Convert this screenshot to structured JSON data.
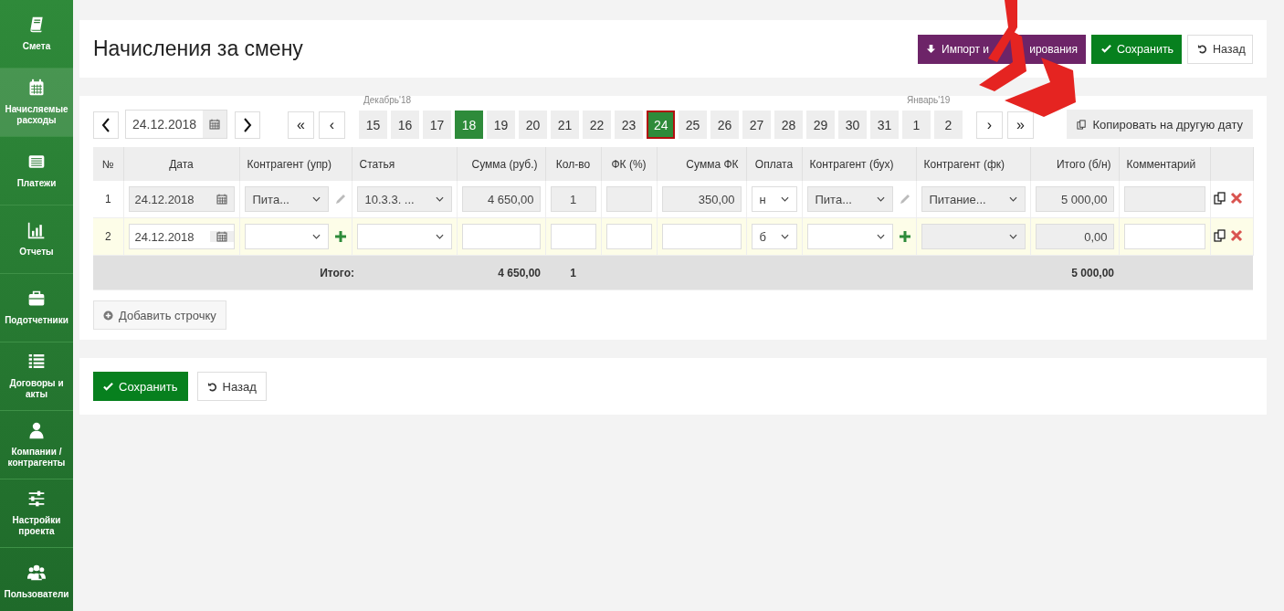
{
  "sidebar": {
    "items": [
      {
        "label": "Смета",
        "selected": false
      },
      {
        "label": "Начисляемые расходы",
        "selected": true
      },
      {
        "label": "Платежи",
        "selected": false
      },
      {
        "label": "Отчеты",
        "selected": false
      },
      {
        "label": "Подотчетники",
        "selected": false
      },
      {
        "label": "Договоры и акты",
        "selected": false
      },
      {
        "label": "Компании / контрагенты",
        "selected": false
      },
      {
        "label": "Настройки проекта",
        "selected": false
      },
      {
        "label": "Пользователи",
        "selected": false
      }
    ]
  },
  "header": {
    "title": "Начисления за смену",
    "buttons": [
      {
        "kind": "import",
        "label_parts": [
          "Импорт и",
          "ирования"
        ]
      },
      {
        "kind": "save",
        "label": "Сохранить"
      },
      {
        "kind": "back",
        "label": "Назад"
      }
    ]
  },
  "calendar": {
    "date": "24.12.2018",
    "first": "«",
    "prev": "‹",
    "next": "›",
    "last": "»",
    "copy_button": "Копировать на другую дату",
    "days": [
      {
        "label": "15",
        "month_label": "Декабрь'18",
        "today": false,
        "selected": false
      },
      {
        "label": "16",
        "today": false,
        "selected": false
      },
      {
        "label": "17",
        "today": false,
        "selected": false
      },
      {
        "label": "18",
        "today": true,
        "selected": false
      },
      {
        "label": "19",
        "today": false,
        "selected": false
      },
      {
        "label": "20",
        "today": false,
        "selected": false
      },
      {
        "label": "21",
        "today": false,
        "selected": false
      },
      {
        "label": "22",
        "today": false,
        "selected": false
      },
      {
        "label": "23",
        "today": false,
        "selected": false
      },
      {
        "label": "24",
        "today": true,
        "selected": true
      },
      {
        "label": "25",
        "today": false,
        "selected": false
      },
      {
        "label": "26",
        "today": false,
        "selected": false
      },
      {
        "label": "27",
        "today": false,
        "selected": false
      },
      {
        "label": "28",
        "today": false,
        "selected": false
      },
      {
        "label": "29",
        "today": false,
        "selected": false
      },
      {
        "label": "30",
        "today": false,
        "selected": false
      },
      {
        "label": "31",
        "today": false,
        "selected": false
      },
      {
        "label": "1",
        "month_label": "Январь'19",
        "today": false,
        "selected": false
      },
      {
        "label": "2",
        "today": false,
        "selected": false
      }
    ]
  },
  "table": {
    "columns": [
      "№",
      "Дата",
      "Контрагент (упр)",
      "Статья",
      "Сумма (руб.)",
      "Кол-во",
      "ФК (%)",
      "Сумма ФК",
      "Оплата",
      "Контрагент (бух)",
      "Контрагент (фк)",
      "Итого (б/н)",
      "Комментарий"
    ],
    "rows": [
      {
        "selected": false,
        "cells": [
          {
            "kind": "number",
            "value": "1"
          },
          {
            "kind": "date",
            "value": "24.12.2018",
            "disabled": true
          },
          {
            "kind": "select",
            "value": "Пита...",
            "disabled": true,
            "editable": true
          },
          {
            "kind": "select",
            "value": "10.3.3. ...",
            "disabled": true
          },
          {
            "kind": "text",
            "value": "4 650,00",
            "disabled": true
          },
          {
            "kind": "text",
            "value": "1",
            "disabled": true
          },
          {
            "kind": "text",
            "disabled": true
          },
          {
            "kind": "text",
            "value": "350,00",
            "disabled": true
          },
          {
            "kind": "select",
            "value": "н",
            "disabled": false
          },
          {
            "kind": "select",
            "value": "Пита...",
            "disabled": true,
            "editable": true
          },
          {
            "kind": "select",
            "value": "Питание...",
            "disabled": true
          },
          {
            "kind": "text",
            "value": "5 000,00",
            "disabled": true
          },
          {
            "kind": "text",
            "disabled": true
          }
        ]
      },
      {
        "selected": true,
        "cells": [
          {
            "kind": "number",
            "value": "2"
          },
          {
            "kind": "date",
            "value": "24.12.2018",
            "disabled": false
          },
          {
            "kind": "select",
            "disabled": false,
            "can_add": true
          },
          {
            "kind": "select",
            "disabled": false
          },
          {
            "kind": "text",
            "disabled": false
          },
          {
            "kind": "text",
            "disabled": false
          },
          {
            "kind": "text",
            "disabled": false
          },
          {
            "kind": "text",
            "disabled": false
          },
          {
            "kind": "select",
            "value": "б",
            "disabled": false
          },
          {
            "kind": "select",
            "disabled": false,
            "can_add": true
          },
          {
            "kind": "select",
            "disabled": true
          },
          {
            "kind": "text",
            "value": "0,00",
            "disabled": true
          },
          {
            "kind": "text",
            "disabled": false
          }
        ]
      }
    ],
    "totals": {
      "label": "Итого:",
      "sum": "4 650,00",
      "quantity": "1",
      "total": "5 000,00"
    }
  },
  "add_row_button": "Добавить строчку",
  "footer": {
    "save": "Сохранить",
    "back": "Назад"
  }
}
